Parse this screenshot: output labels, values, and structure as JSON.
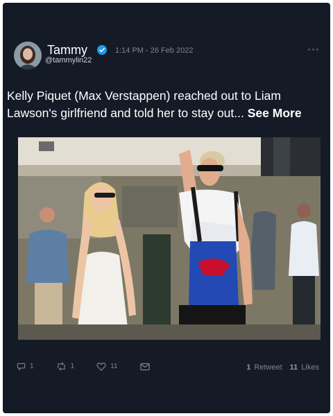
{
  "tweet": {
    "author": {
      "name": "Tammy",
      "handle": "@tammylin22"
    },
    "timestamp": "1:14 PM - 26 Feb 2022",
    "text": "Kelly Piquet (Max Verstappen) reached out to Liam Lawson's girlfriend and told her to stay out...",
    "see_more_label": "See More",
    "actions": {
      "replies": "1",
      "retweets": "1",
      "likes": "11"
    },
    "stats": {
      "retweet_count": "1",
      "retweet_label": "Retweet",
      "like_count": "11",
      "like_label": "Likes"
    }
  },
  "colors": {
    "background": "#151b26",
    "verified_badge": "#1d9bf0",
    "muted_text": "#7d8590"
  },
  "icons": [
    "verified-badge-icon",
    "more-options-icon",
    "reply-icon",
    "retweet-icon",
    "like-icon",
    "share-icon"
  ]
}
